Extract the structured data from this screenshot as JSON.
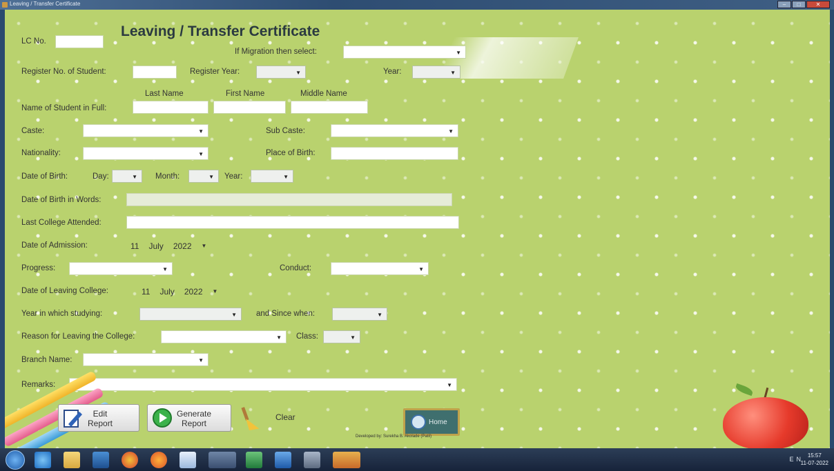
{
  "window": {
    "title": "Leaving / Transfer Certificate"
  },
  "form": {
    "title": "Leaving / Transfer Certificate",
    "lc_no_label": "LC No.",
    "migration_label": "If Migration then select:",
    "register_no_label": "Register No. of Student:",
    "register_year_label": "Register Year:",
    "year_label": "Year:",
    "last_name_label": "Last Name",
    "first_name_label": "First Name",
    "middle_name_label": "Middle Name",
    "name_full_label": "Name of Student in Full:",
    "caste_label": "Caste:",
    "sub_caste_label": "Sub Caste:",
    "nationality_label": "Nationality:",
    "place_of_birth_label": "Place of Birth:",
    "dob_label": "Date of Birth:",
    "day_label": "Day:",
    "month_label": "Month:",
    "dob_year_label": "Year:",
    "dob_words_label": "Date of Birth in Words:",
    "last_college_label": "Last College Attended:",
    "admission_label": "Date of Admission:",
    "admission_day": "11",
    "admission_month": "July",
    "admission_year": "2022",
    "progress_label": "Progress:",
    "conduct_label": "Conduct:",
    "leaving_label": "Date of Leaving College:",
    "leaving_day": "11",
    "leaving_month": "July",
    "leaving_year": "2022",
    "year_studying_label": "Year in which studying:",
    "since_when_label": "and Since when:",
    "reason_label": "Reason for Leaving the College:",
    "class_label": "Class:",
    "branch_label": "Branch Name:",
    "remarks_label": "Remarks:"
  },
  "buttons": {
    "edit_line1": "Edit",
    "edit_line2": "Report",
    "generate_line1": "Generate",
    "generate_line2": "Report",
    "clear": "Clear",
    "home": "Home"
  },
  "footer": {
    "credit": "Developed by: Surekha B. Akolade (Patil)"
  },
  "taskbar": {
    "tray": "EN",
    "time": "15:57",
    "date": "11-07-2022"
  },
  "icons": {
    "start": "windows-start-icon",
    "ie": "internet-explorer-icon",
    "explorer": "file-explorer-icon",
    "media": "media-player-icon",
    "chrome": "chrome-icon",
    "firefox": "firefox-icon",
    "notepad": "notepad-icon",
    "app": "app-icon",
    "excel": "excel-icon",
    "publisher": "publisher-icon",
    "network": "network-icon",
    "active": "active-app-icon"
  }
}
